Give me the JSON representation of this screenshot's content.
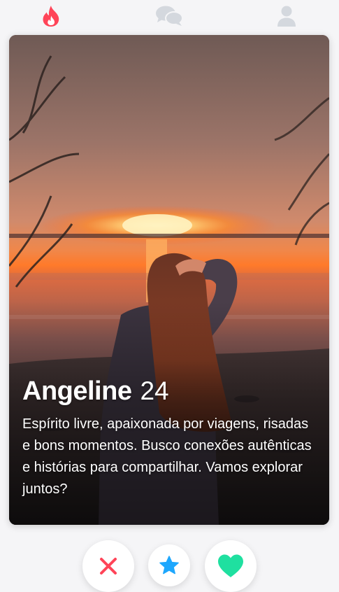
{
  "nav": {
    "items": [
      {
        "icon": "flame-icon",
        "active": true
      },
      {
        "icon": "chat-bubbles-icon",
        "active": false
      },
      {
        "icon": "user-icon",
        "active": false
      }
    ],
    "colors": {
      "active": "#ff4458",
      "inactive": "#d4d8de"
    }
  },
  "profile": {
    "name": "Angeline",
    "age": "24",
    "bio": "Espírito livre, apaixonada por viagens, risadas e bons momentos. Busco conexões autênticas e histórias para compartilhar. Vamos explorar juntos?"
  },
  "actions": {
    "nope": {
      "icon": "close-icon",
      "color": "#ff4458"
    },
    "super_like": {
      "icon": "star-icon",
      "color": "#1ea7fd"
    },
    "like": {
      "icon": "heart-icon",
      "color": "#1fe0a0"
    }
  }
}
